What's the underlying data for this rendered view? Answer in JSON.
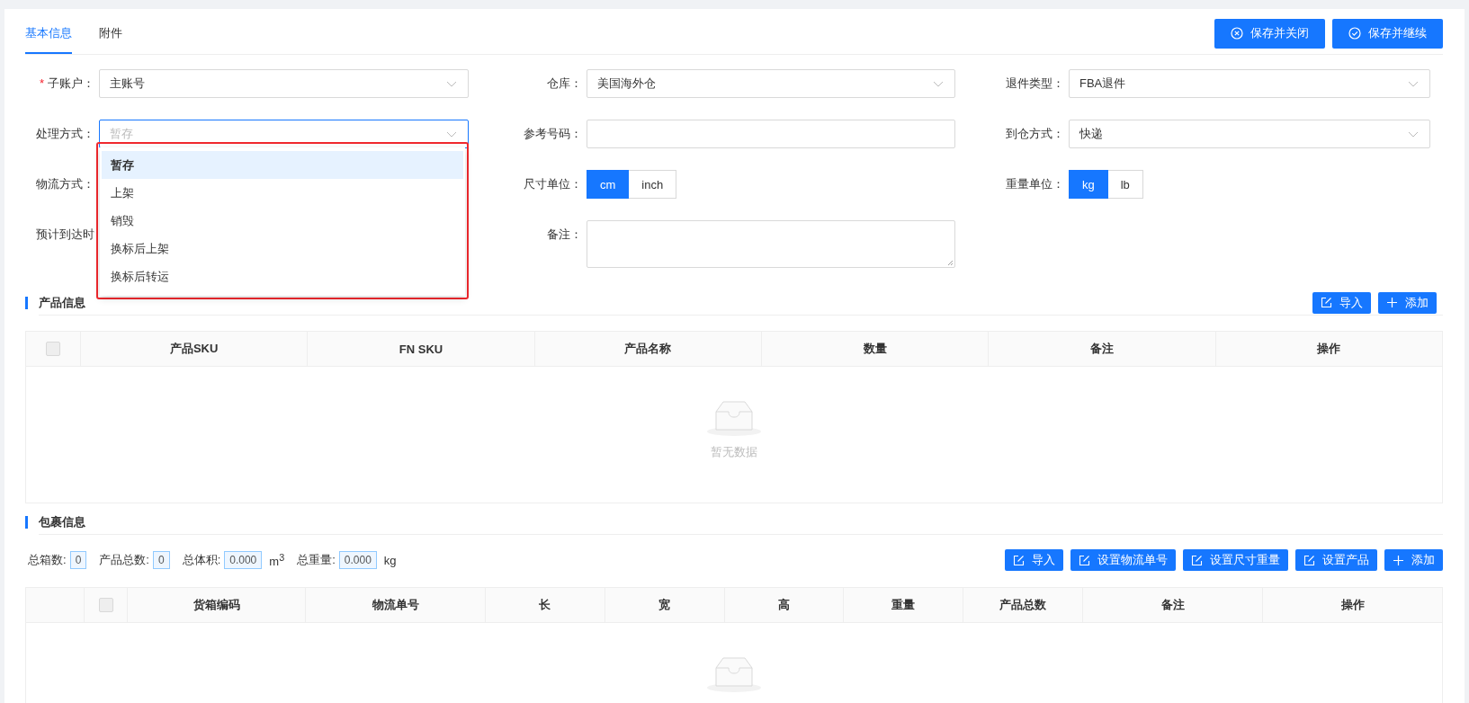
{
  "tabs": [
    {
      "label": "基本信息",
      "selected": true
    },
    {
      "label": "附件",
      "selected": false
    }
  ],
  "header_buttons": [
    {
      "label": "保存并关闭"
    },
    {
      "label": "保存并继续"
    }
  ],
  "form": [
    {
      "required_mark": "*",
      "label": "子账户：",
      "kind": "select",
      "value": "主账号",
      "focused": false
    },
    {
      "label": "仓库：",
      "kind": "select",
      "value": "美国海外仓",
      "focused": false
    },
    {
      "label": "退件类型：",
      "kind": "select",
      "value": "FBA退件",
      "focused": false
    },
    {
      "label": "处理方式：",
      "kind": "select",
      "placeholder": "暂存",
      "focused": true,
      "dropdown": {
        "highlighted": true,
        "options": [
          {
            "label": "暂存",
            "selected": true
          },
          {
            "label": "上架",
            "selected": false
          },
          {
            "label": "销毁",
            "selected": false
          },
          {
            "label": "换标后上架",
            "selected": false
          },
          {
            "label": "换标后转运",
            "selected": false
          }
        ]
      }
    },
    {
      "label": "参考号码：",
      "kind": "input",
      "focused": false
    },
    {
      "label": "到仓方式：",
      "kind": "select",
      "value": "快递",
      "focused": false
    },
    {
      "label": "物流方式：",
      "kind": "covered"
    },
    {
      "label": "尺寸单位：",
      "kind": "segmented",
      "options": [
        {
          "label": "cm",
          "selected": true
        },
        {
          "label": "inch",
          "selected": false
        }
      ]
    },
    {
      "label": "重量单位：",
      "kind": "segmented",
      "options": [
        {
          "label": "kg",
          "selected": true
        },
        {
          "label": "lb",
          "selected": false
        }
      ]
    },
    {
      "label": "预计到达时",
      "kind": "covered"
    },
    {
      "label": "备注：",
      "kind": "textarea",
      "focused": false
    }
  ],
  "product_section": {
    "title": "产品信息",
    "buttons": [
      {
        "label": "导入"
      },
      {
        "label": "添加"
      }
    ],
    "table": {
      "select_all_checked": false,
      "columns": [
        "产品SKU",
        "FN SKU",
        "产品名称",
        "数量",
        "备注",
        "操作"
      ],
      "empty_text": "暂无数据"
    }
  },
  "package_section": {
    "title": "包裹信息",
    "summary": [
      {
        "label": "总箱数:",
        "value": "0"
      },
      {
        "label": "产品总数:",
        "value": "0"
      },
      {
        "label": "总体积:",
        "value": "0.000",
        "unit": "m$^{3}$"
      },
      {
        "label": "总重量:",
        "value": "0.000",
        "unit": "kg"
      }
    ],
    "buttons": [
      {
        "label": "导入"
      },
      {
        "label": "设置物流单号"
      },
      {
        "label": "设置尺寸重量"
      },
      {
        "label": "设置产品"
      },
      {
        "label": "添加"
      }
    ],
    "table": {
      "select_all_checked": false,
      "columns": [
        "货箱编码",
        "物流单号",
        "长",
        "宽",
        "高",
        "重量",
        "产品总数",
        "备注",
        "操作"
      ]
    }
  }
}
